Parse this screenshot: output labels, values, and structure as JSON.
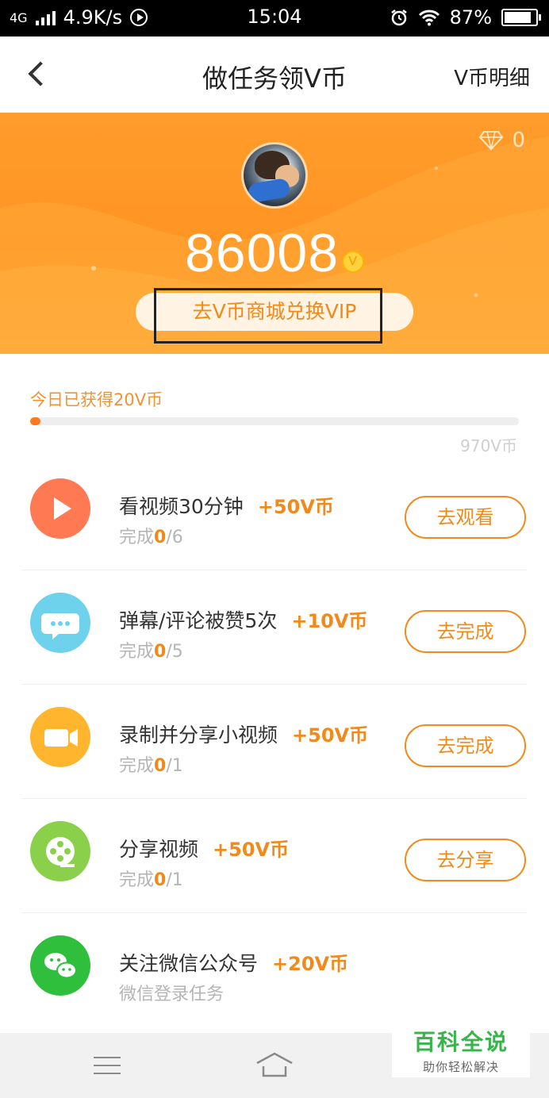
{
  "status_bar": {
    "network": "4G",
    "speed": "4.9K/s",
    "time": "15:04",
    "battery": "87%",
    "battery_level": 0.87
  },
  "nav": {
    "title": "做任务领V币",
    "right_link": "V币明细"
  },
  "hero": {
    "diamonds": "0",
    "balance": "86008",
    "coin_symbol": "V",
    "exchange_button": "去V币商城兑换VIP"
  },
  "progress": {
    "label": "今日已获得20V币",
    "max_label": "970V币",
    "fraction": 0.021
  },
  "tasks": [
    {
      "title": "看视频30分钟",
      "reward": "+50V币",
      "status_prefix": "完成",
      "done": "0",
      "total": "/6",
      "button": "去观看",
      "icon": "play-icon",
      "color": "#ff7a52"
    },
    {
      "title": "弹幕/评论被赞5次",
      "reward": "+10V币",
      "status_prefix": "完成",
      "done": "0",
      "total": "/5",
      "button": "去完成",
      "icon": "chat-bubble-icon",
      "color": "#6fd2ec"
    },
    {
      "title": "录制并分享小视频",
      "reward": "+50V币",
      "status_prefix": "完成",
      "done": "0",
      "total": "/1",
      "button": "去完成",
      "icon": "video-camera-icon",
      "color": "#ffb52e"
    },
    {
      "title": "分享视频",
      "reward": "+50V币",
      "status_prefix": "完成",
      "done": "0",
      "total": "/1",
      "button": "去分享",
      "icon": "film-reel-icon",
      "color": "#8bd04a"
    },
    {
      "title": "关注微信公众号",
      "reward": "+20V币",
      "subtitle": "微信登录任务",
      "icon": "wechat-icon",
      "color": "#2fbf3c"
    }
  ],
  "watermark": {
    "title": "百科全说",
    "subtitle": "助你轻松解决"
  }
}
